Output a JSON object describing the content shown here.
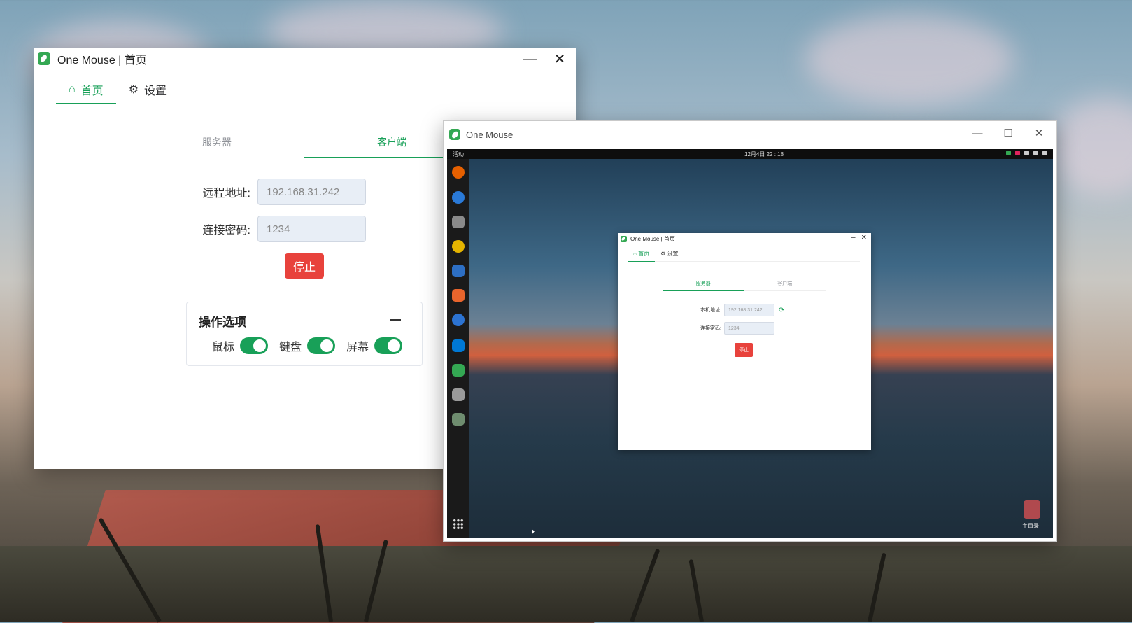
{
  "main_window": {
    "title": "One Mouse | 首页",
    "minimize": "—",
    "close": "✕",
    "nav": [
      {
        "icon": "⌂",
        "label": "首页"
      },
      {
        "icon": "⚙",
        "label": "设置"
      }
    ],
    "sub_tabs": [
      "服务器",
      "客户端"
    ],
    "form": {
      "address_label": "远程地址:",
      "address_value": "192.168.31.242",
      "password_label": "连接密码:",
      "password_value": "1234"
    },
    "stop_label": "停止",
    "options": {
      "title": "操作选项",
      "items": [
        {
          "label": "鼠标",
          "on": true
        },
        {
          "label": "键盘",
          "on": true
        },
        {
          "label": "屏幕",
          "on": true
        }
      ]
    }
  },
  "remote_window": {
    "title": "One Mouse",
    "minimize": "—",
    "maximize": "☐",
    "close": "✕",
    "desktop": {
      "activities": "活动",
      "clock": "12月4日 22 : 18",
      "home_label": "主目录",
      "app": {
        "title": "One Mouse | 首页",
        "nav": [
          {
            "icon": "⌂",
            "label": "首页"
          },
          {
            "icon": "⚙",
            "label": "设置"
          }
        ],
        "sub_tabs": [
          "服务器",
          "客户端"
        ],
        "address_label": "本机地址:",
        "address_value": "192.168.31.242",
        "password_label": "连接密码:",
        "password_value": "1234",
        "stop_label": "停止"
      }
    }
  }
}
